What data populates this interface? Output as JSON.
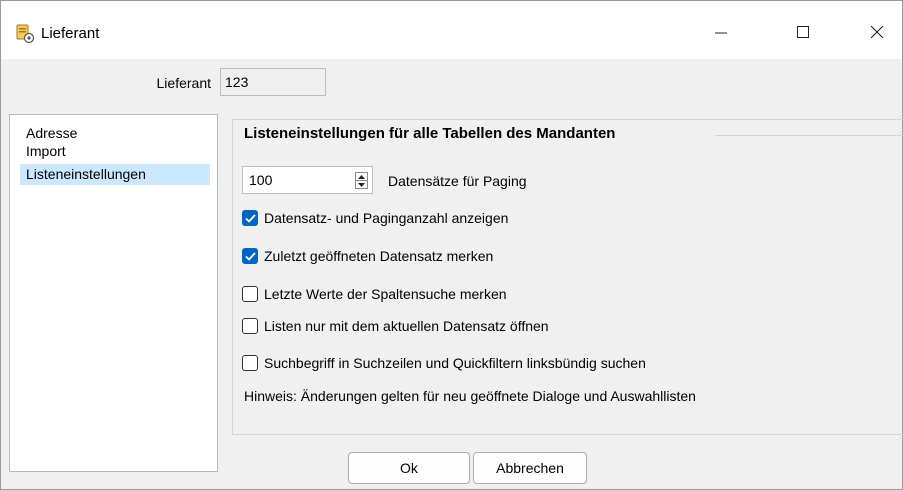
{
  "window": {
    "title": "Lieferant",
    "icons": {
      "app": "supplier-gear-icon",
      "minimize": "minimize-icon",
      "maximize": "maximize-icon",
      "close": "close-icon"
    }
  },
  "supplier": {
    "label": "Lieferant",
    "value": "123"
  },
  "nav": {
    "items": [
      {
        "label": "Adresse",
        "selected": false
      },
      {
        "label": "Import",
        "selected": false
      },
      {
        "label": "Listeneinstellungen",
        "selected": true
      }
    ],
    "selected_color": "#cce8ff"
  },
  "settings": {
    "group_title": "Listeneinstellungen für alle Tabellen des Mandanten",
    "paging": {
      "value": "100",
      "label": "Datensätze für Paging"
    },
    "options": [
      {
        "label": "Datensatz- und Paginganzahl anzeigen",
        "checked": true
      },
      {
        "label": "Zuletzt geöffneten Datensatz merken",
        "checked": true
      },
      {
        "label": "Letzte Werte der Spaltensuche merken",
        "checked": false
      },
      {
        "label": "Listen nur mit dem aktuellen Datensatz öffnen",
        "checked": false
      },
      {
        "label": "Suchbegriff in Suchzeilen und Quickfiltern linksbündig suchen",
        "checked": false
      }
    ],
    "hint": "Hinweis: Änderungen gelten für neu geöffnete Dialoge und Auswahllisten"
  },
  "buttons": {
    "ok": "Ok",
    "cancel": "Abbrechen"
  },
  "colors": {
    "accent": "#0067c0",
    "window_bg": "#f0f0f0"
  }
}
